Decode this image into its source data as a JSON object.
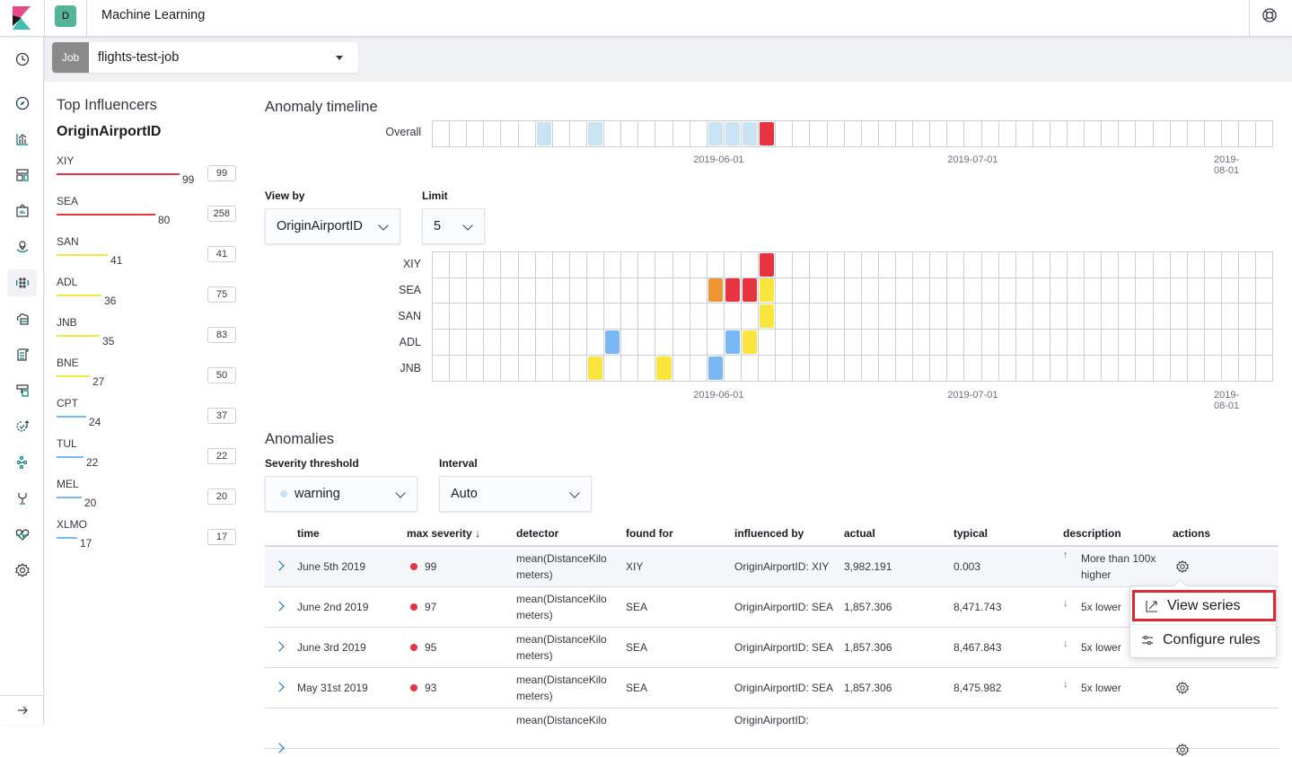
{
  "header": {
    "app_title": "Machine Learning",
    "space_initial": "D",
    "space_color": "#54b399"
  },
  "sidenav": {
    "items": [
      {
        "name": "recently-viewed",
        "icon": "clock-icon"
      },
      {
        "name": "discover",
        "icon": "compass-icon"
      },
      {
        "name": "visualize",
        "icon": "chart-icon"
      },
      {
        "name": "dashboard",
        "icon": "dashboard-icon"
      },
      {
        "name": "canvas",
        "icon": "canvas-icon"
      },
      {
        "name": "maps",
        "icon": "map-icon"
      },
      {
        "name": "machine-learning",
        "icon": "ml-icon",
        "active": true
      },
      {
        "name": "infrastructure",
        "icon": "infra-icon"
      },
      {
        "name": "logs",
        "icon": "logs-icon"
      },
      {
        "name": "apm",
        "icon": "apm-icon"
      },
      {
        "name": "uptime",
        "icon": "uptime-icon"
      },
      {
        "name": "graph",
        "icon": "graph-icon"
      },
      {
        "name": "dev-tools",
        "icon": "devtools-icon"
      },
      {
        "name": "monitoring",
        "icon": "heartbeat-icon"
      },
      {
        "name": "management",
        "icon": "gear-icon"
      }
    ],
    "collapse_icon": "arrow-right-icon"
  },
  "job_selector": {
    "prefix": "Job",
    "value": "flights-test-job"
  },
  "influencers": {
    "title": "Top Influencers",
    "field": "OriginAirportID",
    "items": [
      {
        "name": "XIY",
        "max_score": 99,
        "total": 99,
        "color": "#e7353f"
      },
      {
        "name": "SEA",
        "max_score": 80,
        "total": 258,
        "color": "#e7353f"
      },
      {
        "name": "SAN",
        "max_score": 41,
        "total": 41,
        "color": "#fbe43b"
      },
      {
        "name": "ADL",
        "max_score": 36,
        "total": 75,
        "color": "#fbe43b"
      },
      {
        "name": "JNB",
        "max_score": 35,
        "total": 83,
        "color": "#fbe43b"
      },
      {
        "name": "BNE",
        "max_score": 27,
        "total": 50,
        "color": "#fbe43b"
      },
      {
        "name": "CPT",
        "max_score": 24,
        "total": 37,
        "color": "#7ab8f5"
      },
      {
        "name": "TUL",
        "max_score": 22,
        "total": 22,
        "color": "#7ab8f5"
      },
      {
        "name": "MEL",
        "max_score": 20,
        "total": 20,
        "color": "#7ab8f5"
      },
      {
        "name": "XLMO",
        "max_score": 17,
        "total": 17,
        "color": "#7ab8f5"
      }
    ]
  },
  "timeline": {
    "title": "Anomaly timeline",
    "cell_count": 49,
    "date_ticks": [
      {
        "label": "2019-06-01",
        "cell_pos": 16.7
      },
      {
        "label": "2019-07-01",
        "cell_pos": 31.5
      },
      {
        "label": "2019-08-01",
        "cell_pos": 46.7
      }
    ],
    "severity_colors": {
      "low": "#c9e3f5",
      "warning": "#7ab8f5",
      "minor": "#fbe43b",
      "major": "#ef9633",
      "critical": "#e7353f"
    },
    "overall": {
      "label": "Overall",
      "cells": [
        {
          "index": 6,
          "severity": "low"
        },
        {
          "index": 9,
          "severity": "low"
        },
        {
          "index": 16,
          "severity": "low"
        },
        {
          "index": 17,
          "severity": "low"
        },
        {
          "index": 18,
          "severity": "low"
        },
        {
          "index": 19,
          "severity": "critical"
        }
      ]
    },
    "view_by": {
      "label": "View by",
      "value": "OriginAirportID"
    },
    "limit": {
      "label": "Limit",
      "value": "5"
    },
    "swimlanes": [
      {
        "label": "XIY",
        "cells": [
          {
            "index": 19,
            "severity": "critical"
          }
        ]
      },
      {
        "label": "SEA",
        "cells": [
          {
            "index": 16,
            "severity": "major"
          },
          {
            "index": 17,
            "severity": "critical"
          },
          {
            "index": 18,
            "severity": "critical"
          },
          {
            "index": 19,
            "severity": "minor"
          }
        ]
      },
      {
        "label": "SAN",
        "cells": [
          {
            "index": 19,
            "severity": "minor"
          }
        ]
      },
      {
        "label": "ADL",
        "cells": [
          {
            "index": 10,
            "severity": "warning"
          },
          {
            "index": 17,
            "severity": "warning"
          },
          {
            "index": 18,
            "severity": "minor"
          }
        ]
      },
      {
        "label": "JNB",
        "cells": [
          {
            "index": 9,
            "severity": "minor"
          },
          {
            "index": 13,
            "severity": "minor"
          },
          {
            "index": 16,
            "severity": "warning"
          }
        ]
      }
    ]
  },
  "anomalies": {
    "title": "Anomalies",
    "severity_threshold": {
      "label": "Severity threshold",
      "value": "warning",
      "dot_color": "#c9e3f5"
    },
    "interval": {
      "label": "Interval",
      "value": "Auto"
    },
    "columns": [
      "time",
      "max severity",
      "detector",
      "found for",
      "influenced by",
      "actual",
      "typical",
      "description",
      "actions"
    ],
    "sort_icon": "arrow-down-icon",
    "rows": [
      {
        "time": "June 5th 2019",
        "severity": "99",
        "detector": [
          "mean(DistanceKilo",
          "meters)"
        ],
        "found_for": "XIY",
        "influenced_by": [
          "OriginAirportID: XIY"
        ],
        "actual": "3,982.191",
        "typical": "0.003",
        "direction": "↑",
        "description": [
          "More than 100x",
          "higher"
        ]
      },
      {
        "time": "June 2nd 2019",
        "severity": "97",
        "detector": [
          "mean(DistanceKilo",
          "meters)"
        ],
        "found_for": "SEA",
        "influenced_by": [
          "OriginAirportID: SEA"
        ],
        "actual": "1,857.306",
        "typical": "8,471.743",
        "direction": "↓",
        "description": [
          "5x lower"
        ]
      },
      {
        "time": "June 3rd 2019",
        "severity": "95",
        "detector": [
          "mean(DistanceKilo",
          "meters)"
        ],
        "found_for": "SEA",
        "influenced_by": [
          "OriginAirportID: SEA"
        ],
        "actual": "1,857.306",
        "typical": "8,467.843",
        "direction": "↓",
        "description": [
          "5x lower"
        ]
      },
      {
        "time": "May 31st 2019",
        "severity": "93",
        "detector": [
          "mean(DistanceKilo",
          "meters)"
        ],
        "found_for": "SEA",
        "influenced_by": [
          "OriginAirportID: SEA"
        ],
        "actual": "1,857.306",
        "typical": "8,475.982",
        "direction": "↓",
        "description": [
          "5x lower"
        ]
      },
      {
        "time": "",
        "severity": "",
        "detector": [
          "mean(DistanceKilo",
          ""
        ],
        "found_for": "",
        "influenced_by": [
          "OriginAirportID:"
        ],
        "actual": "",
        "typical": "",
        "direction": "↓",
        "description": [
          ""
        ]
      }
    ]
  },
  "actions_popover": {
    "items": [
      {
        "label": "View series",
        "icon": "chart-line-icon",
        "highlighted": true
      },
      {
        "label": "Configure rules",
        "icon": "controls-icon"
      }
    ]
  }
}
